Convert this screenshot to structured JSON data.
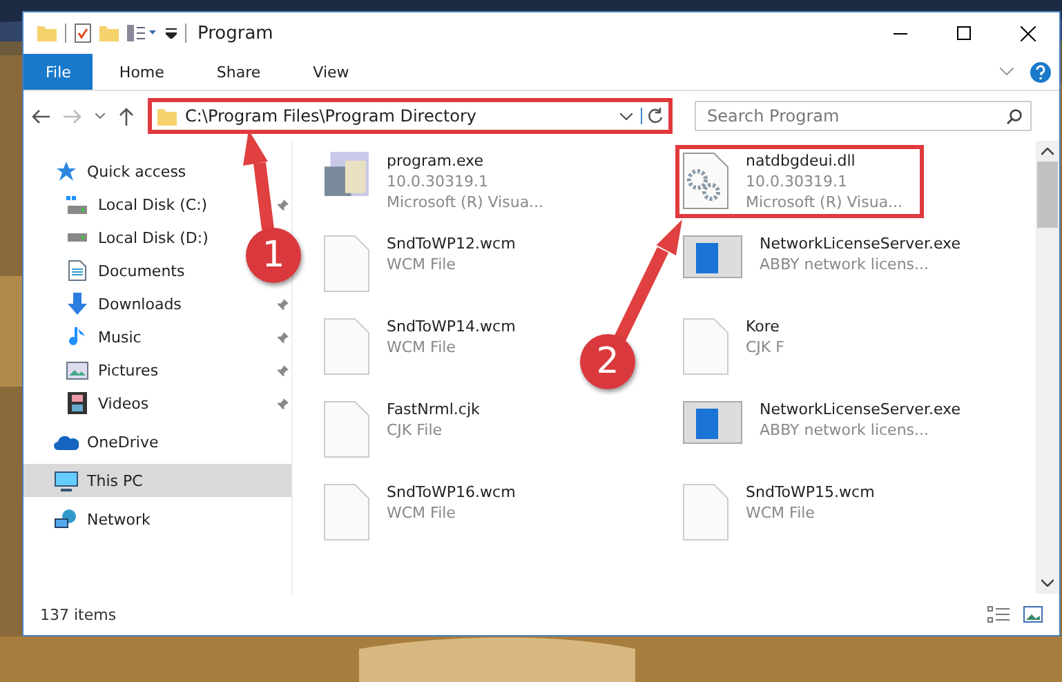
{
  "window": {
    "title": "Program"
  },
  "ribbon_tabs": [
    {
      "label": "File",
      "selected": true
    },
    {
      "label": "Home",
      "selected": false
    },
    {
      "label": "Share",
      "selected": false
    },
    {
      "label": "View",
      "selected": false
    }
  ],
  "address_bar": {
    "path": "C:\\Program Files\\Program Directory",
    "highlighted": true
  },
  "search": {
    "placeholder": "Search Program"
  },
  "sidebar": {
    "items": [
      {
        "label": "Quick access",
        "selected": false,
        "children": [
          {
            "label": "Local Disk (C:)",
            "pinned": true
          },
          {
            "label": "Local Disk (D:)",
            "pinned": false
          },
          {
            "label": "Documents",
            "pinned": false
          },
          {
            "label": "Downloads",
            "pinned": true
          },
          {
            "label": "Music",
            "pinned": true
          },
          {
            "label": "Pictures",
            "pinned": true
          },
          {
            "label": "Videos",
            "pinned": true
          }
        ]
      },
      {
        "label": "OneDrive",
        "selected": false
      },
      {
        "label": "This PC",
        "selected": true
      },
      {
        "label": "Network",
        "selected": false
      }
    ]
  },
  "files": [
    {
      "name": "program.exe",
      "details": [
        "10.0.30319.1",
        "Microsoft (R) Visua..."
      ],
      "kind": "exe",
      "highlighted": false
    },
    {
      "name": "natdbgdeui.dll",
      "details": [
        "10.0.30319.1",
        "Microsoft (R) Visua..."
      ],
      "kind": "dll",
      "highlighted": true
    },
    {
      "name": "SndToWP12.wcm",
      "details": [
        "WCM File"
      ],
      "kind": "doc",
      "highlighted": false
    },
    {
      "name": "NetworkLicenseServer.exe",
      "details": [
        "ABBY network licens..."
      ],
      "kind": "app",
      "highlighted": false
    },
    {
      "name": "SndToWP14.wcm",
      "details": [
        "WCM File"
      ],
      "kind": "doc",
      "highlighted": false
    },
    {
      "name": "Kore",
      "details": [
        "CJK F"
      ],
      "kind": "doc",
      "highlighted": false
    },
    {
      "name": "FastNrml.cjk",
      "details": [
        "CJK File"
      ],
      "kind": "doc",
      "highlighted": false
    },
    {
      "name": "NetworkLicenseServer.exe",
      "details": [
        "ABBY network licens..."
      ],
      "kind": "app",
      "highlighted": false
    },
    {
      "name": "SndToWP16.wcm",
      "details": [
        "WCM File"
      ],
      "kind": "doc",
      "highlighted": false
    },
    {
      "name": "SndToWP15.wcm",
      "details": [
        "WCM File"
      ],
      "kind": "doc",
      "highlighted": false
    }
  ],
  "status_bar": {
    "item_count": "137 items"
  },
  "callouts": [
    {
      "number": "1"
    },
    {
      "number": "2"
    }
  ]
}
